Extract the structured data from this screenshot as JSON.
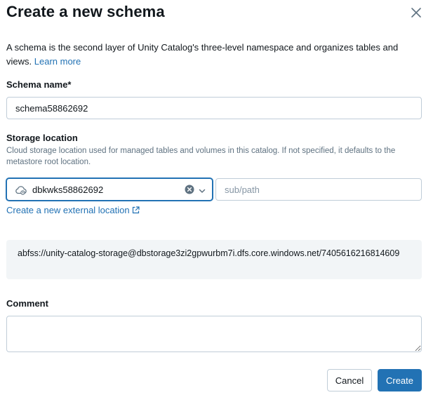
{
  "dialog": {
    "title": "Create a new schema",
    "description": "A schema is the second layer of Unity Catalog's three-level namespace and organizes tables and views.",
    "learn_more": "Learn more"
  },
  "schema_name": {
    "label": "Schema name*",
    "value": "schema58862692"
  },
  "storage": {
    "label": "Storage location",
    "hint": "Cloud storage location used for managed tables and volumes in this catalog. If not specified, it defaults to the metastore root location.",
    "selected_location": "dbkwks58862692",
    "subpath_placeholder": "sub/path",
    "create_external_link": "Create a new external location",
    "resolved_path": "abfss://unity-catalog-storage@dbstorage3zi2gpwurbm7i.dfs.core.windows.net/7405616216814609"
  },
  "comment": {
    "label": "Comment",
    "value": ""
  },
  "buttons": {
    "cancel": "Cancel",
    "create": "Create"
  },
  "icons": {
    "close": "close-icon",
    "cloud": "cloud-icon",
    "clear": "clear-circle-icon",
    "chevron": "chevron-down-icon",
    "external": "external-link-icon"
  },
  "colors": {
    "accent": "#2272b4",
    "path_background": "#f2f5f7"
  }
}
